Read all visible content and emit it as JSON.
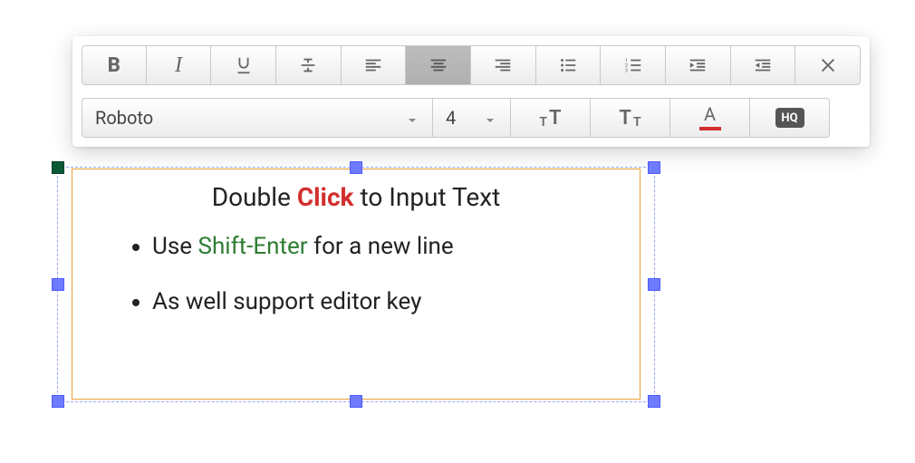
{
  "toolbar": {
    "row1": {
      "bold": {
        "active": false
      },
      "italic": {
        "active": false
      },
      "underline": {
        "active": false
      },
      "strike": {
        "active": false
      },
      "align_left": {
        "active": false
      },
      "align_center": {
        "active": true
      },
      "align_right": {
        "active": false
      },
      "list_bullet": {
        "active": false
      },
      "list_number": {
        "active": false
      },
      "indent": {
        "active": false
      },
      "outdent": {
        "active": false
      },
      "close": {
        "active": false
      }
    },
    "row2": {
      "font_family": {
        "value": "Roboto"
      },
      "font_size": {
        "value": "4"
      },
      "increase_size": {},
      "decrease_size": {},
      "font_color": {
        "swatch": "#d32f2f"
      },
      "hq_badge": {
        "label": "HQ"
      }
    }
  },
  "textbox": {
    "title": {
      "before": "Double ",
      "emph": "Click",
      "after": " to Input Text"
    },
    "bullets": [
      {
        "before": "Use ",
        "emph": "Shift-Enter",
        "after": " for a new line"
      },
      {
        "plain": "As well support editor key"
      }
    ]
  },
  "selection": {
    "handles": [
      "tl",
      "tm",
      "tr",
      "ml",
      "mr",
      "bl",
      "bm",
      "br"
    ],
    "rotate_handle": true
  }
}
